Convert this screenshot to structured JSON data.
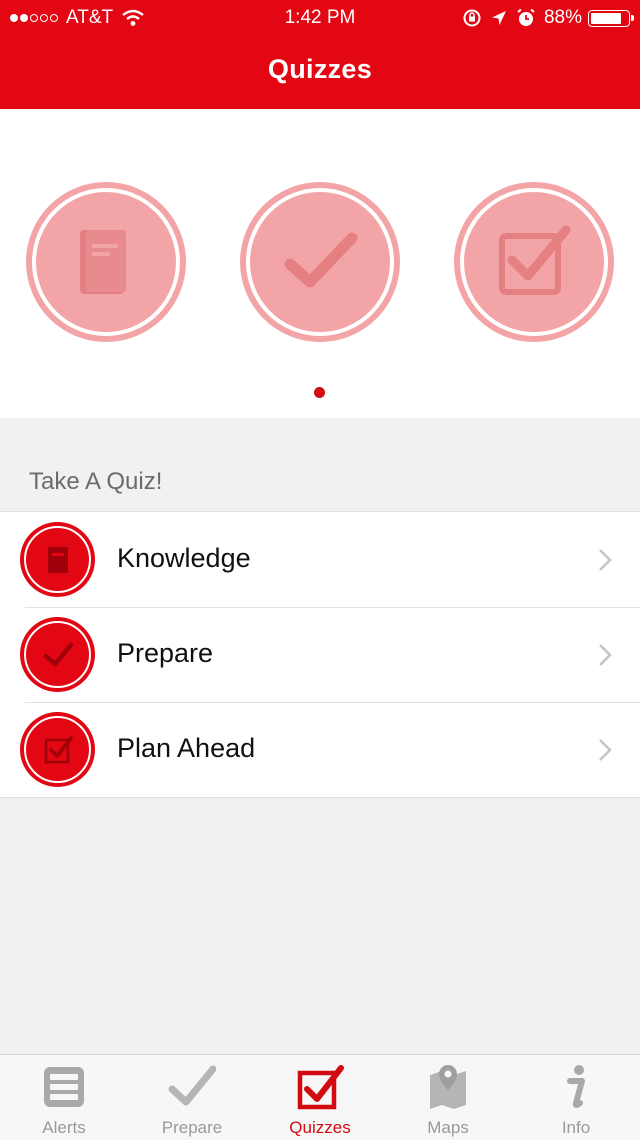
{
  "status_bar": {
    "carrier": "AT&T",
    "time": "1:42 PM",
    "battery": "88%",
    "battery_level": 0.88,
    "signal_bars": 2
  },
  "header": {
    "title": "Quizzes"
  },
  "carousel": {
    "slides": [
      {
        "icon": "book-icon"
      },
      {
        "icon": "check-icon"
      },
      {
        "icon": "checkbox-icon"
      }
    ],
    "page_count": 1,
    "current_page": 1
  },
  "section": {
    "title": "Take A Quiz!"
  },
  "quizzes": [
    {
      "label": "Knowledge",
      "icon": "book-icon"
    },
    {
      "label": "Prepare",
      "icon": "check-icon"
    },
    {
      "label": "Plan Ahead",
      "icon": "checkbox-icon"
    }
  ],
  "tabs": [
    {
      "label": "Alerts",
      "icon": "list-icon"
    },
    {
      "label": "Prepare",
      "icon": "check-icon"
    },
    {
      "label": "Quizzes",
      "icon": "checkbox-icon",
      "active": true
    },
    {
      "label": "Maps",
      "icon": "map-pin-icon"
    },
    {
      "label": "Info",
      "icon": "info-icon"
    }
  ],
  "colors": {
    "brand_red": "#e30613",
    "faded_red": "#f3a4a6",
    "inactive_tab": "#9a9a9a"
  }
}
